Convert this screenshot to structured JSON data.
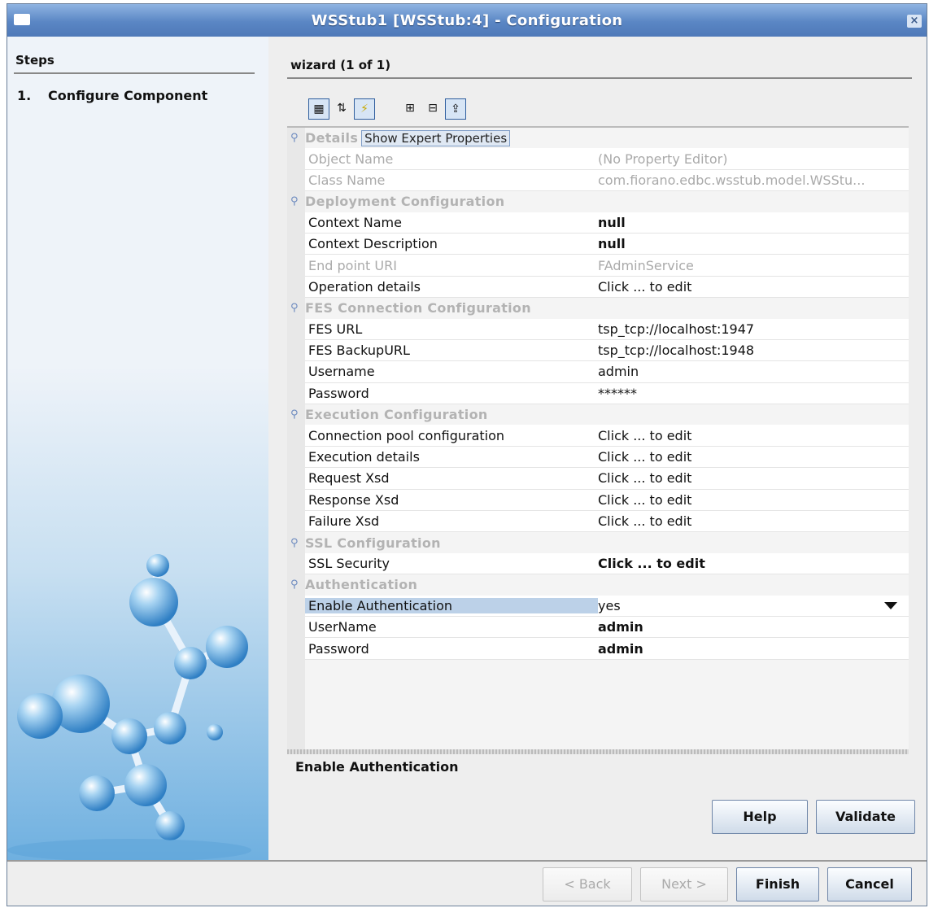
{
  "window": {
    "title": "WSStub1 [WSStub:4] - Configuration",
    "close_label": "×"
  },
  "steps_panel": {
    "heading": "Steps",
    "items": [
      {
        "number": "1.",
        "label": "Configure Component"
      }
    ]
  },
  "wizard": {
    "heading": "wizard (1 of 1)"
  },
  "property_sheet": {
    "details": {
      "title": "Details",
      "expert_button": "Show Expert Properties",
      "rows": [
        {
          "name": "Object Name",
          "value": "(No Property Editor)"
        },
        {
          "name": "Class Name",
          "value": "com.fiorano.edbc.wsstub.model.WSStu..."
        }
      ]
    },
    "deployment": {
      "title": "Deployment Configuration",
      "rows": [
        {
          "name": "Context Name",
          "value": "null"
        },
        {
          "name": "Context Description",
          "value": "null"
        },
        {
          "name": "End point URI",
          "value": "FAdminService"
        },
        {
          "name": "Operation details",
          "value": "Click ... to edit"
        }
      ]
    },
    "fes": {
      "title": "FES Connection Configuration",
      "rows": [
        {
          "name": "FES URL",
          "value": "tsp_tcp://localhost:1947"
        },
        {
          "name": "FES BackupURL",
          "value": "tsp_tcp://localhost:1948"
        },
        {
          "name": "Username",
          "value": "admin"
        },
        {
          "name": "Password",
          "value": "******"
        }
      ]
    },
    "execution": {
      "title": "Execution Configuration",
      "rows": [
        {
          "name": "Connection pool configuration",
          "value": "Click ... to edit"
        },
        {
          "name": "Execution details",
          "value": "Click ... to edit"
        },
        {
          "name": "Request Xsd",
          "value": "Click ... to edit"
        },
        {
          "name": "Response Xsd",
          "value": "Click ... to edit"
        },
        {
          "name": "Failure Xsd",
          "value": "Click ... to edit"
        }
      ]
    },
    "ssl": {
      "title": "SSL Configuration",
      "rows": [
        {
          "name": "SSL Security",
          "value": "Click ... to edit"
        }
      ]
    },
    "auth": {
      "title": "Authentication",
      "rows": [
        {
          "name": "Enable Authentication",
          "value": "yes"
        },
        {
          "name": "UserName",
          "value": "admin"
        },
        {
          "name": "Password",
          "value": "admin"
        }
      ]
    }
  },
  "description": "Enable Authentication",
  "buttons": {
    "help": "Help",
    "validate": "Validate",
    "back": "< Back",
    "next": "Next >",
    "finish": "Finish",
    "cancel": "Cancel"
  },
  "colors": {
    "titlebar": "#5a86c4",
    "selection": "#bcd1e8",
    "category_text": "#b3b3b3"
  }
}
